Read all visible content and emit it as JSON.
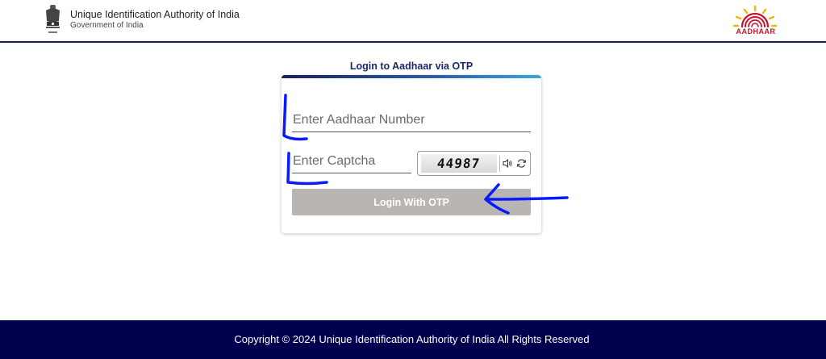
{
  "header": {
    "org_title": "Unique Identification Authority of India",
    "org_subtitle": "Government of India",
    "logo_word": "AADHAAR",
    "emblem_icon": "emblem-icon",
    "logo_icon": "aadhaar-logo-icon"
  },
  "login": {
    "title": "Login to Aadhaar via OTP",
    "aadhaar_placeholder": "Enter Aadhaar Number",
    "aadhaar_value": "",
    "captcha_placeholder": "Enter Captcha",
    "captcha_value": "",
    "captcha_text": "44987",
    "speaker_icon": "speaker-icon",
    "refresh_icon": "refresh-icon",
    "login_button": "Login With OTP"
  },
  "footer": {
    "copyright": "Copyright © 2024 Unique Identification Authority of India All Rights Reserved"
  },
  "colors": {
    "header_border": "#1a1f5c",
    "title": "#1a2a6c",
    "button_disabled": "#b8b5b3",
    "footer_bg": "#00004f",
    "annotation": "#0a1aff",
    "logo_red": "#c8102e",
    "logo_yellow": "#f2b705"
  }
}
